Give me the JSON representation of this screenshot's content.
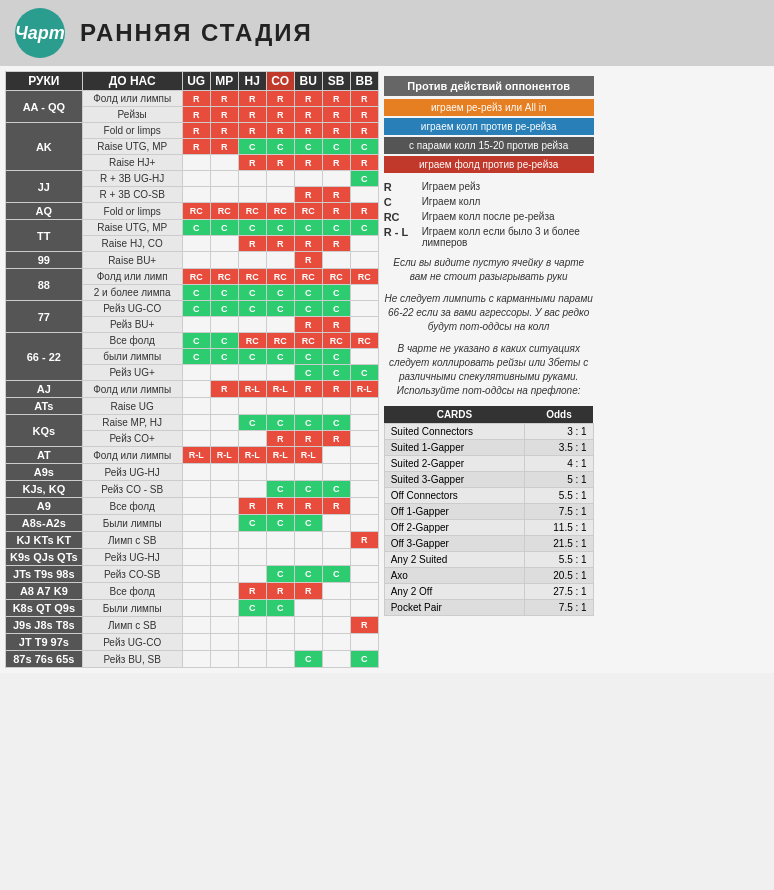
{
  "header": {
    "logo": "Чарт",
    "title": "РАННЯЯ СТАДИЯ"
  },
  "columns": [
    "UG",
    "MP",
    "HJ",
    "CO",
    "BU",
    "SB",
    "BB"
  ],
  "col_headers": [
    "РУКИ",
    "ДО НАС",
    "UG",
    "MP",
    "HJ",
    "CO",
    "BU",
    "SB",
    "BB"
  ],
  "rows": [
    {
      "hand": "AA - QQ",
      "actions": [
        {
          "desc": "Фолд или лимпы",
          "cells": [
            "R",
            "R",
            "R",
            "R",
            "R",
            "R",
            "R"
          ]
        },
        {
          "desc": "Рейзы",
          "cells": [
            "R",
            "R",
            "R",
            "R",
            "R",
            "R",
            "R"
          ]
        }
      ]
    },
    {
      "hand": "AK",
      "actions": [
        {
          "desc": "Fold or limps",
          "cells": [
            "R",
            "R",
            "R",
            "R",
            "R",
            "R",
            "R"
          ]
        },
        {
          "desc": "Raise UTG, MP",
          "cells": [
            "R",
            "R",
            "C",
            "C",
            "C",
            "C",
            "C"
          ]
        },
        {
          "desc": "Raise HJ+",
          "cells": [
            "",
            "",
            "R",
            "R",
            "R",
            "R",
            "R"
          ]
        }
      ]
    },
    {
      "hand": "JJ",
      "actions": [
        {
          "desc": "R + 3B UG-HJ",
          "cells": [
            "",
            "",
            "",
            "",
            "",
            "",
            "C"
          ]
        },
        {
          "desc": "R + 3B CO-SB",
          "cells": [
            "",
            "",
            "",
            "",
            "R",
            "R",
            ""
          ]
        }
      ]
    },
    {
      "hand": "AQ",
      "actions": [
        {
          "desc": "Fold or limps",
          "cells": [
            "RC",
            "RC",
            "RC",
            "RC",
            "RC",
            "R",
            "R"
          ]
        }
      ]
    },
    {
      "hand": "TT",
      "actions": [
        {
          "desc": "Raise UTG, MP",
          "cells": [
            "C",
            "C",
            "C",
            "C",
            "C",
            "C",
            "C"
          ]
        },
        {
          "desc": "Raise HJ, CO",
          "cells": [
            "",
            "",
            "R",
            "R",
            "R",
            "R",
            ""
          ]
        }
      ]
    },
    {
      "hand": "99",
      "actions": [
        {
          "desc": "Raise BU+",
          "cells": [
            "",
            "",
            "",
            "",
            "R",
            "",
            ""
          ]
        }
      ]
    },
    {
      "hand": "88",
      "actions": [
        {
          "desc": "Фолд или лимп",
          "cells": [
            "RC",
            "RC",
            "RC",
            "RC",
            "RC",
            "RC",
            "RC"
          ]
        },
        {
          "desc": "2 и более лимпа",
          "cells": [
            "C",
            "C",
            "C",
            "C",
            "C",
            "C",
            ""
          ]
        }
      ]
    },
    {
      "hand": "77",
      "actions": [
        {
          "desc": "Рейз UG-CO",
          "cells": [
            "C",
            "C",
            "C",
            "C",
            "C",
            "C",
            ""
          ]
        },
        {
          "desc": "Рейз BU+",
          "cells": [
            "",
            "",
            "",
            "",
            "R",
            "R",
            ""
          ]
        }
      ]
    },
    {
      "hand": "66 - 22",
      "actions": [
        {
          "desc": "Все фолд",
          "cells": [
            "C",
            "C",
            "RC",
            "RC",
            "RC",
            "RC",
            "RC"
          ]
        },
        {
          "desc": "были лимпы",
          "cells": [
            "C",
            "C",
            "C",
            "C",
            "C",
            "C",
            ""
          ]
        },
        {
          "desc": "Рейз UG+",
          "cells": [
            "",
            "",
            "",
            "",
            "C",
            "C",
            "C"
          ]
        }
      ]
    },
    {
      "hand": "AJ",
      "actions": [
        {
          "desc": "Фолд или лимпы",
          "cells": [
            "",
            "R",
            "R-L",
            "R-L",
            "R",
            "R",
            "R-L"
          ]
        }
      ]
    },
    {
      "hand": "ATs",
      "actions": [
        {
          "desc": "Raise UG",
          "cells": [
            "",
            "",
            "",
            "",
            "",
            "",
            ""
          ]
        }
      ]
    },
    {
      "hand": "KQs",
      "actions": [
        {
          "desc": "Raise MP, HJ",
          "cells": [
            "",
            "",
            "C",
            "C",
            "C",
            "C",
            ""
          ]
        },
        {
          "desc": "Рейз CO+",
          "cells": [
            "",
            "",
            "",
            "R",
            "R",
            "R",
            ""
          ]
        }
      ]
    },
    {
      "hand": "AT",
      "actions": [
        {
          "desc": "Фолд или лимпы",
          "cells": [
            "R-L",
            "R-L",
            "R-L",
            "R-L",
            "R-L",
            "",
            ""
          ]
        }
      ]
    },
    {
      "hand": "A9s",
      "actions": [
        {
          "desc": "Рейз UG-HJ",
          "cells": [
            "",
            "",
            "",
            "",
            "",
            "",
            ""
          ]
        }
      ]
    },
    {
      "hand": "KJs, KQ",
      "actions": [
        {
          "desc": "Рейз CO - SB",
          "cells": [
            "",
            "",
            "",
            "C",
            "C",
            "C",
            ""
          ]
        }
      ]
    },
    {
      "hand": "A9",
      "actions": [
        {
          "desc": "Все фолд",
          "cells": [
            "",
            "",
            "R",
            "R",
            "R",
            "R",
            ""
          ]
        }
      ]
    },
    {
      "hand": "A8s-A2s",
      "actions": [
        {
          "desc": "Были лимпы",
          "cells": [
            "",
            "",
            "C",
            "C",
            "C",
            "",
            ""
          ]
        }
      ]
    },
    {
      "hand": "KJ  KTs  KT",
      "actions": [
        {
          "desc": "Лимп с SB",
          "cells": [
            "",
            "",
            "",
            "",
            "",
            "",
            "R"
          ]
        }
      ]
    },
    {
      "hand": "K9s QJs QTs",
      "actions": [
        {
          "desc": "Рейз UG-HJ",
          "cells": [
            "",
            "",
            "",
            "",
            "",
            "",
            ""
          ]
        }
      ]
    },
    {
      "hand": "JTs T9s 98s",
      "actions": [
        {
          "desc": "Рейз CO-SB",
          "cells": [
            "",
            "",
            "",
            "C",
            "C",
            "C",
            ""
          ]
        }
      ]
    },
    {
      "hand": "A8  A7  K9",
      "actions": [
        {
          "desc": "Все фолд",
          "cells": [
            "",
            "",
            "R",
            "R",
            "R",
            "",
            ""
          ]
        }
      ]
    },
    {
      "hand": "K8s  QT  Q9s",
      "actions": [
        {
          "desc": "Были лимпы",
          "cells": [
            "",
            "",
            "C",
            "C",
            "",
            "",
            ""
          ]
        }
      ]
    },
    {
      "hand": "J9s  J8s  T8s",
      "actions": [
        {
          "desc": "Лимп с SB",
          "cells": [
            "",
            "",
            "",
            "",
            "",
            "",
            "R"
          ]
        }
      ]
    },
    {
      "hand": "JT  T9  97s",
      "actions": [
        {
          "desc": "Рейз UG-CO",
          "cells": [
            "",
            "",
            "",
            "",
            "",
            "",
            ""
          ]
        }
      ]
    },
    {
      "hand": "87s 76s 65s",
      "actions": [
        {
          "desc": "Рейз BU, SB",
          "cells": [
            "",
            "",
            "",
            "",
            "C",
            "",
            "C"
          ]
        }
      ]
    }
  ],
  "right_panel": {
    "vs_header": "Против действий оппонентов",
    "legend_items": [
      {
        "color": "orange",
        "text": "играем ре-рейз или All in"
      },
      {
        "color": "blue",
        "text": "играем колл против ре-рейза"
      },
      {
        "color": "dark",
        "text": "с парами колл 15-20 против рейза"
      },
      {
        "color": "red",
        "text": "играем фолд против ре-рейза"
      }
    ],
    "codes": [
      {
        "key": "R",
        "desc": "Играем рейз"
      },
      {
        "key": "C",
        "desc": "Играем колл"
      },
      {
        "key": "RC",
        "desc": "Играем колл после ре-рейза"
      },
      {
        "key": "R - L",
        "desc": "Играем колл если было 3 и более лимперов"
      }
    ],
    "note1": "Если вы видите пустую ячейку в чарте вам не стоит разыгрывать руки",
    "note2": "Не следует лимпить с карманными парами 66-22 если за вами агрессоры. У вас редко будут пот-оддсы на колл",
    "note3": "В чарте не указано в каких ситуациях следует коллировать рейзы или 3беты с различными спекулятивными руками. Используйте пот-оддсы на префлопе:",
    "odds_table": {
      "headers": [
        "CARDS",
        "Odds"
      ],
      "rows": [
        [
          "Suited Connectors",
          "3 : 1"
        ],
        [
          "Suited 1-Gapper",
          "3.5 : 1"
        ],
        [
          "Suited 2-Gapper",
          "4 : 1"
        ],
        [
          "Suited 3-Gapper",
          "5 : 1"
        ],
        [
          "Off Connectors",
          "5.5 : 1"
        ],
        [
          "Off 1-Gapper",
          "7.5 : 1"
        ],
        [
          "Off 2-Gapper",
          "11.5 : 1"
        ],
        [
          "Off 3-Gapper",
          "21.5 : 1"
        ],
        [
          "Any 2 Suited",
          "5.5 : 1"
        ],
        [
          "Axo",
          "20.5 : 1"
        ],
        [
          "Any 2 Off",
          "27.5 : 1"
        ],
        [
          "Pocket Pair",
          "7.5 : 1"
        ]
      ]
    }
  }
}
